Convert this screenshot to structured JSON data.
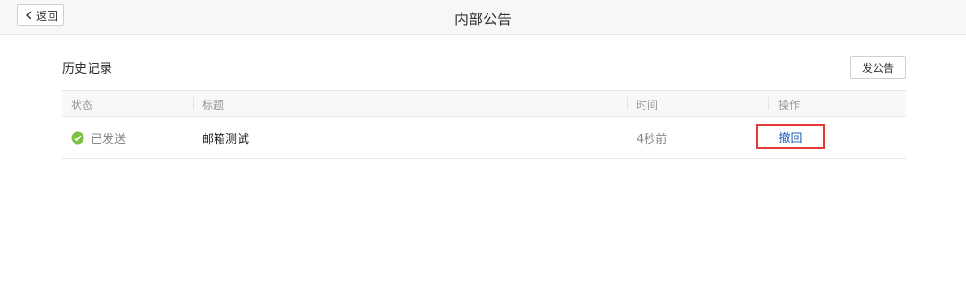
{
  "header": {
    "back_label": "返回",
    "title": "内部公告"
  },
  "section": {
    "title": "历史记录",
    "post_button": "发公告"
  },
  "table": {
    "columns": [
      "状态",
      "标题",
      "时间",
      "操作"
    ],
    "rows": [
      {
        "status": "已发送",
        "title": "邮箱测试",
        "time": "4秒前",
        "action": "撤回"
      }
    ]
  },
  "colors": {
    "success": "#7cc142",
    "link": "#1d5fb8",
    "highlight": "#e53935"
  },
  "icons": {
    "back": "chevron-left-icon",
    "status": "check-circle-icon"
  }
}
